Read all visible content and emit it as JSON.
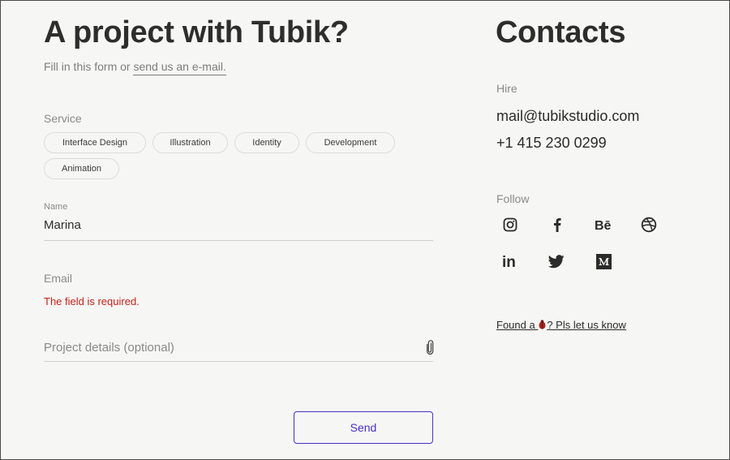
{
  "form": {
    "title": "A project with Tubik?",
    "subtitle_prefix": "Fill in this form or ",
    "subtitle_link": "send us an e-mail.",
    "service_label": "Service",
    "services": [
      "Interface Design",
      "Illustration",
      "Identity",
      "Development",
      "Animation"
    ],
    "name_label": "Name",
    "name_value": "Marina",
    "email_label": "Email",
    "email_error": "The field is required.",
    "details_placeholder": "Project details (optional)",
    "send_label": "Send",
    "accent_color": "#4a2fc4",
    "error_color": "#c2221c"
  },
  "contacts": {
    "title": "Contacts",
    "hire_label": "Hire",
    "email": "mail@tubikstudio.com",
    "phone": "+1 415 230 0299",
    "follow_label": "Follow",
    "social_icons": [
      "instagram-icon",
      "facebook-icon",
      "behance-icon",
      "dribbble-icon",
      "linkedin-icon",
      "twitter-icon",
      "medium-icon"
    ],
    "bug_prefix": "Found a ",
    "bug_suffix": "? Pls let us know"
  }
}
